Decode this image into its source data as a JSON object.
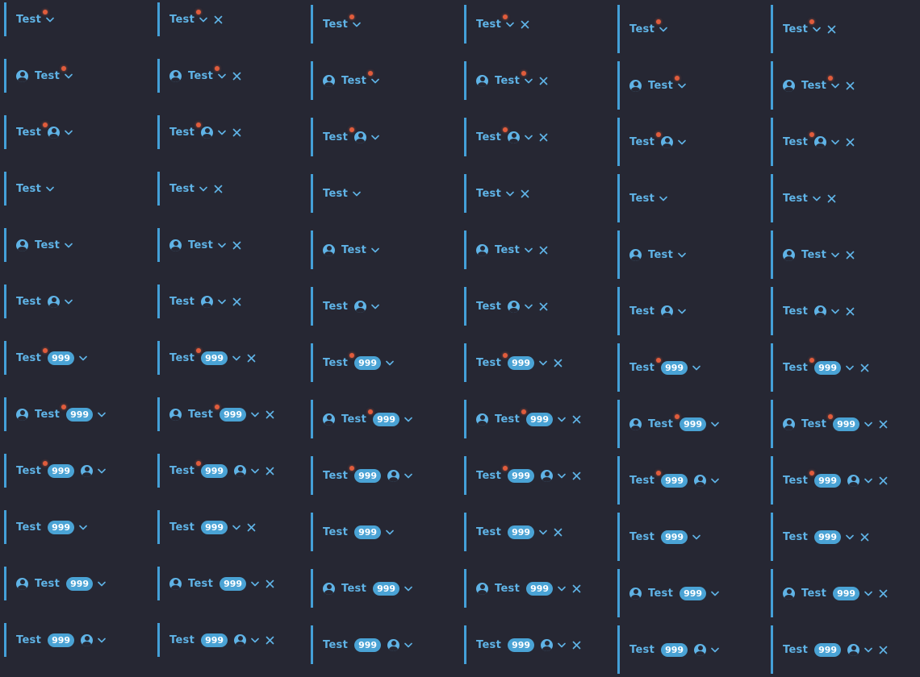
{
  "tab_label": "Test",
  "badge_count": "999",
  "colors": {
    "background": "#262733",
    "accent": "#44a0d8",
    "text": "#5fb3e6",
    "notification_dot": "#e05c3c",
    "badge": "#4aa3d5"
  },
  "icons": {
    "avatar": "account-circle-icon",
    "dropdown": "chevron-down-icon",
    "close": "close-icon"
  },
  "variants": [
    {
      "leading_avatar": false,
      "dot": true,
      "badge": false,
      "trailing_avatar": false
    },
    {
      "leading_avatar": true,
      "dot": true,
      "badge": false,
      "trailing_avatar": false
    },
    {
      "leading_avatar": false,
      "dot": true,
      "badge": false,
      "trailing_avatar": true
    },
    {
      "leading_avatar": false,
      "dot": false,
      "badge": false,
      "trailing_avatar": false
    },
    {
      "leading_avatar": true,
      "dot": false,
      "badge": false,
      "trailing_avatar": false
    },
    {
      "leading_avatar": false,
      "dot": false,
      "badge": false,
      "trailing_avatar": true
    },
    {
      "leading_avatar": false,
      "dot": true,
      "badge": true,
      "trailing_avatar": false
    },
    {
      "leading_avatar": true,
      "dot": true,
      "badge": true,
      "trailing_avatar": false
    },
    {
      "leading_avatar": false,
      "dot": true,
      "badge": true,
      "trailing_avatar": true
    },
    {
      "leading_avatar": false,
      "dot": false,
      "badge": true,
      "trailing_avatar": false
    },
    {
      "leading_avatar": true,
      "dot": false,
      "badge": true,
      "trailing_avatar": false
    },
    {
      "leading_avatar": false,
      "dot": false,
      "badge": true,
      "trailing_avatar": true
    }
  ],
  "column_configs": [
    {
      "size": "small",
      "closable": false
    },
    {
      "size": "small",
      "closable": true
    },
    {
      "size": "medium",
      "closable": false
    },
    {
      "size": "medium",
      "closable": true
    },
    {
      "size": "large",
      "closable": false
    },
    {
      "size": "large",
      "closable": true
    }
  ]
}
